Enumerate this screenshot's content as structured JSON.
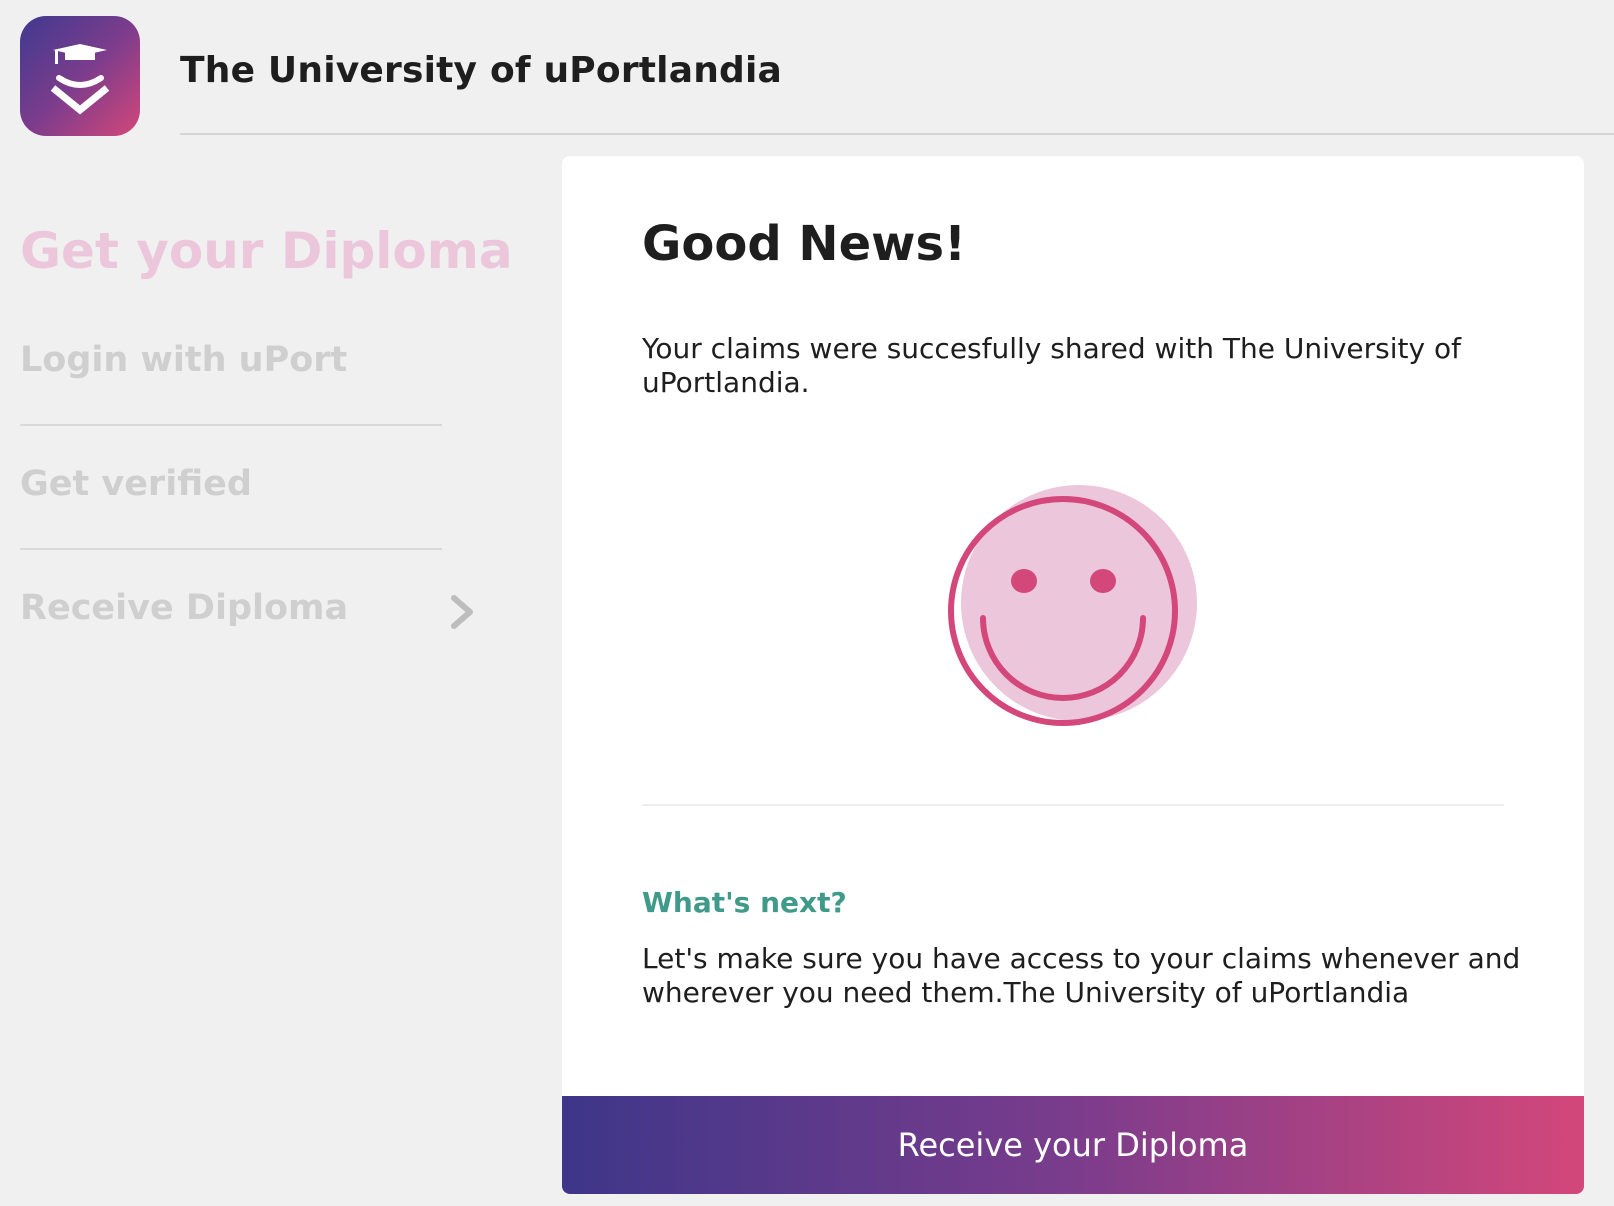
{
  "header": {
    "title": "The University of uPortlandia",
    "logo_icon": "graduation-cap-shield-icon"
  },
  "sidebar": {
    "title": "Get your Diploma",
    "steps": [
      {
        "label": "Login with uPort"
      },
      {
        "label": "Get verified"
      },
      {
        "label": "Receive Diploma",
        "icon": "chevron-right-icon"
      }
    ]
  },
  "card": {
    "title": "Good News!",
    "message": "Your claims were succesfully shared with The University of uPortlandia.",
    "illustration": "smiley-face-icon",
    "next_heading": "What's next?",
    "next_text": "Let's make sure you have access to your claims whenever and wherever you need them.The University of uPortlandia",
    "button_label": "Receive your Diploma"
  },
  "colors": {
    "background": "#f0f0f0",
    "accent_pink": "#d3477a",
    "accent_purple": "#3f3a8f",
    "teal": "#3f9a8a",
    "sidebar_title": "#ecc7dc",
    "step_text": "#cfcfcf"
  }
}
